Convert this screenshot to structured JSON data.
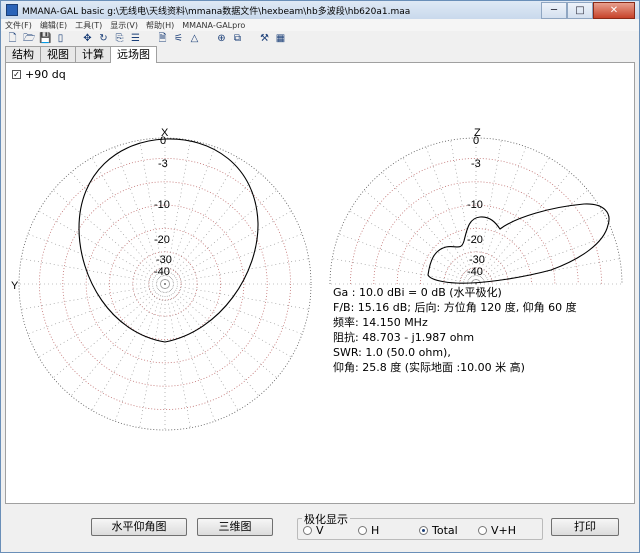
{
  "window": {
    "title": "MMANA-GAL basic g:\\无线电\\天线资料\\mmana数据文件\\hexbeam\\hb多波段\\hb620a1.maa",
    "minimize": "─",
    "maximize": "□",
    "close": "✕"
  },
  "menu": [
    "文件(F)",
    "编辑(E)",
    "工具(T)",
    "显示(V)",
    "帮助(H)",
    "MMANA-GALpro"
  ],
  "toolbar": [
    "🗋",
    "🗁",
    "💾",
    "▯",
    "✥",
    "↻",
    "⎘",
    "☰",
    "🗎",
    "⚟",
    "△",
    "⊕",
    "⧉",
    "⚒",
    "▦"
  ],
  "tabs": [
    "结构",
    "视图",
    "计算",
    "远场图"
  ],
  "active_tab": "远场图",
  "elevation_check": {
    "checked": true,
    "label": "+90 dq"
  },
  "left_plot": {
    "top_axis": "X",
    "left_axis": "Y",
    "ring_labels": [
      "0",
      "-3",
      "-10",
      "-20",
      "-30",
      "-40"
    ]
  },
  "right_plot": {
    "top_axis": "Z",
    "ring_labels": [
      "0",
      "-3",
      "-10",
      "-20",
      "-30",
      "-40"
    ]
  },
  "info": [
    "Ga : 10.0 dBi = 0 dB  (水平极化)",
    "F/B: 15.16 dB; 后向: 方位角 120 度,  仰角 60 度",
    "频率: 14.150 MHz",
    "阻抗: 48.703 - j1.987 ohm",
    "SWR: 1.0 (50.0 ohm),",
    "仰角: 25.8 度 (实际地面  :10.00 米 高)"
  ],
  "buttons": {
    "horizontal": "水平仰角图",
    "three_d": "三维图",
    "print": "打印"
  },
  "polarization": {
    "label": "极化显示",
    "options": [
      "V",
      "H",
      "Total",
      "V+H"
    ],
    "selected": "Total"
  },
  "colors": {
    "grid": "#c07070",
    "pattern": "#000000",
    "title_bar": "#c9d9ec"
  }
}
